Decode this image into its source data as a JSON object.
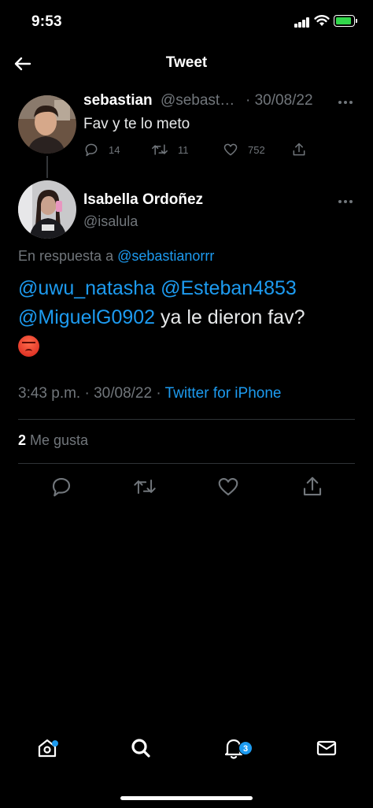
{
  "status_bar": {
    "time": "9:53"
  },
  "header": {
    "title": "Tweet"
  },
  "parent_tweet": {
    "name": "sebastian",
    "handle": "@sebast…",
    "separator": " · ",
    "date": "30/08/22",
    "text": "Fav y te lo meto",
    "replies": "14",
    "retweets": "11",
    "likes": "752"
  },
  "main_tweet": {
    "name": "Isabella Ordoñez",
    "handle": "@isalula",
    "reply_prefix": "En respuesta a ",
    "reply_to": "@sebastianorrr",
    "mention_1": "@uwu_natasha",
    "mention_2": "@Esteban4853",
    "mention_3": "@MiguelG0902",
    "text": " ya le dieron fav?",
    "time": "3:43 p.m.",
    "dot_1": " · ",
    "date": "30/08/22",
    "dot_2": " · ",
    "source": "Twitter for iPhone",
    "like_count": "2",
    "like_label": " Me gusta"
  },
  "bottom_nav": {
    "notification_badge": "3"
  },
  "colors": {
    "accent": "#1d9bf0",
    "background": "#000000",
    "secondary_text": "#71767b",
    "primary_text": "#e7e9ea"
  },
  "icons": [
    "back-arrow-icon",
    "more-icon",
    "reply-icon",
    "retweet-icon",
    "like-icon",
    "share-icon",
    "home-icon",
    "search-icon",
    "notifications-icon",
    "messages-icon"
  ]
}
